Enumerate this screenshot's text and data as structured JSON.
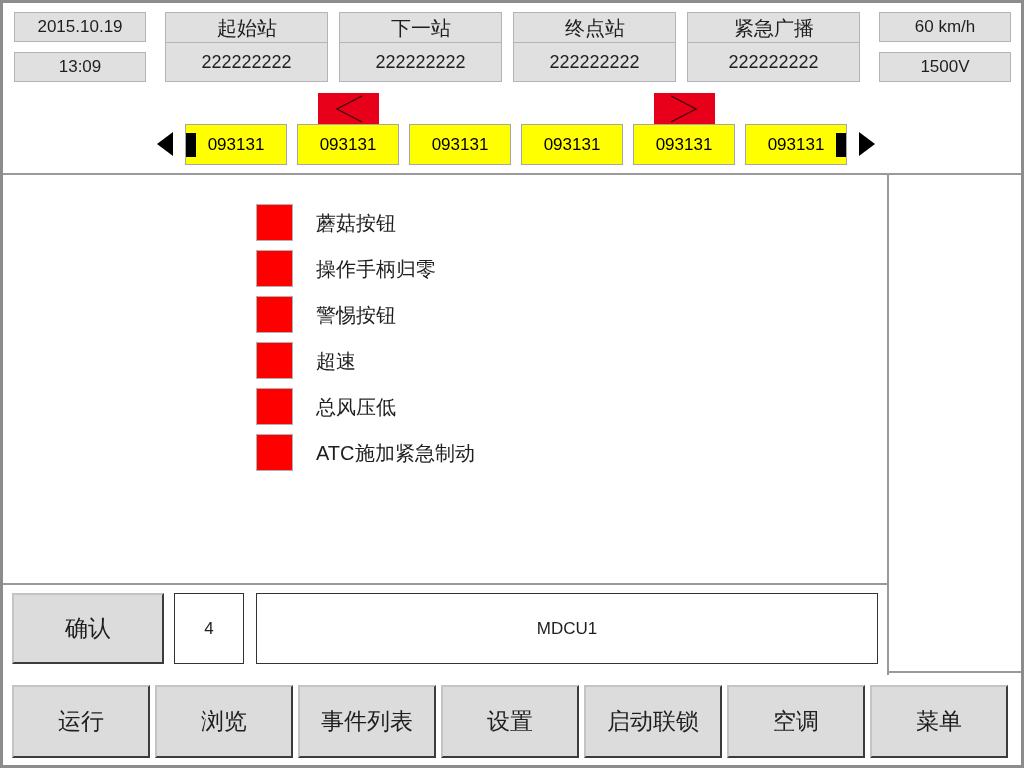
{
  "header": {
    "date": "2015.10.19",
    "time": "13:09",
    "stations": [
      {
        "label": "起始站",
        "value": "222222222"
      },
      {
        "label": "下一站",
        "value": "222222222"
      },
      {
        "label": "终点站",
        "value": "222222222"
      },
      {
        "label": "紧急广播",
        "value": "222222222"
      }
    ],
    "speed": "60 km/h",
    "voltage": "1500V"
  },
  "train": {
    "cars": [
      {
        "label": "093131",
        "kind": "lead",
        "left_arrow": false,
        "right_arrow": false
      },
      {
        "label": "093131",
        "kind": "middle",
        "left_arrow": true,
        "right_arrow": false
      },
      {
        "label": "093131",
        "kind": "middle",
        "left_arrow": false,
        "right_arrow": false
      },
      {
        "label": "093131",
        "kind": "middle",
        "left_arrow": false,
        "right_arrow": false
      },
      {
        "label": "093131",
        "kind": "middle",
        "left_arrow": false,
        "right_arrow": true
      },
      {
        "label": "093131",
        "kind": "trail",
        "left_arrow": false,
        "right_arrow": false
      }
    ]
  },
  "alarms": [
    {
      "label": "蘑菇按钮",
      "active": true
    },
    {
      "label": "操作手柄归零",
      "active": true
    },
    {
      "label": "警惕按钮",
      "active": true
    },
    {
      "label": "超速",
      "active": true
    },
    {
      "label": "总风压低",
      "active": true
    },
    {
      "label": "ATC施加紧急制动",
      "active": true
    }
  ],
  "confirm": {
    "button": "确认",
    "count": "4",
    "device": "MDCU1"
  },
  "nav_buttons": [
    "运行",
    "浏览",
    "事件列表",
    "设置",
    "启动联锁",
    "空调",
    "菜单"
  ]
}
